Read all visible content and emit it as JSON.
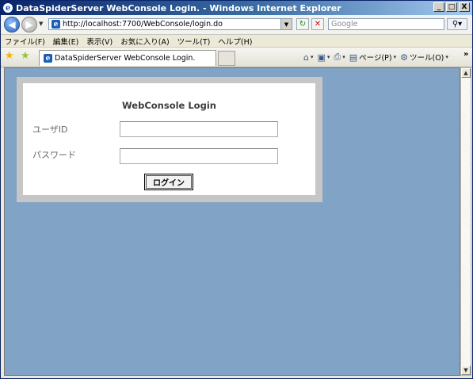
{
  "window": {
    "title": "DataSpiderServer WebConsole Login. - Windows Internet Explorer",
    "controls": [
      "_",
      "□",
      "X"
    ]
  },
  "toolbar": {
    "address": "http://localhost:7700/WebConsole/login.do",
    "search_placeholder": "Google"
  },
  "menu": [
    "ファイル(F)",
    "編集(E)",
    "表示(V)",
    "お気に入り(A)",
    "ツール(T)",
    "ヘルプ(H)"
  ],
  "tab": {
    "label": "DataSpiderServer WebConsole Login."
  },
  "commandbar": {
    "page_label": "ページ(P)",
    "tools_label": "ツール(O)"
  },
  "login": {
    "title": "WebConsole Login",
    "user_label": "ユーザID",
    "password_label": "パスワード",
    "user_value": "",
    "password_value": "",
    "button_label": "ログイン"
  },
  "colors": {
    "page_background": "#81a3c6",
    "panel_border": "#c6c6c6",
    "titlebar": "#0a246a"
  },
  "icons": [
    "ie-logo-icon",
    "back-arrow-icon",
    "forward-arrow-icon",
    "page-icon",
    "refresh-icon",
    "stop-icon",
    "search-icon",
    "favorites-star-icon",
    "add-favorites-icon",
    "home-icon",
    "feeds-icon",
    "print-icon",
    "page-menu-icon",
    "tools-gear-icon",
    "chevron-icon"
  ]
}
